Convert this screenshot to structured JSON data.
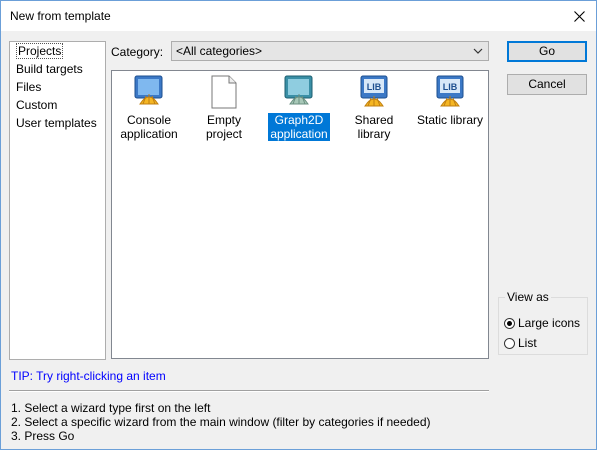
{
  "window": {
    "title": "New from template"
  },
  "sidebar": {
    "items": [
      {
        "label": "Projects"
      },
      {
        "label": "Build targets"
      },
      {
        "label": "Files"
      },
      {
        "label": "Custom"
      },
      {
        "label": "User templates"
      }
    ]
  },
  "category": {
    "label": "Category:",
    "value": "<All categories>"
  },
  "templates": [
    {
      "label": "Console\napplication"
    },
    {
      "label": "Empty\nproject"
    },
    {
      "label": "Graph2D\napplication"
    },
    {
      "label": "Shared\nlibrary",
      "badge": "LIB"
    },
    {
      "label": "Static library",
      "badge": "LIB"
    }
  ],
  "buttons": {
    "go": "Go",
    "cancel": "Cancel"
  },
  "view_as": {
    "legend": "View as",
    "large_icons": "Large icons",
    "list": "List"
  },
  "tip": "TIP: Try right-clicking an item",
  "instructions": [
    "1. Select a wizard type first on the left",
    "2. Select a specific wizard from the main window (filter by categories if needed)",
    "3. Press Go"
  ],
  "colors": {
    "selection": "#0078d7",
    "tip": "#0000ff",
    "accent_border": "#6b9fd8"
  }
}
